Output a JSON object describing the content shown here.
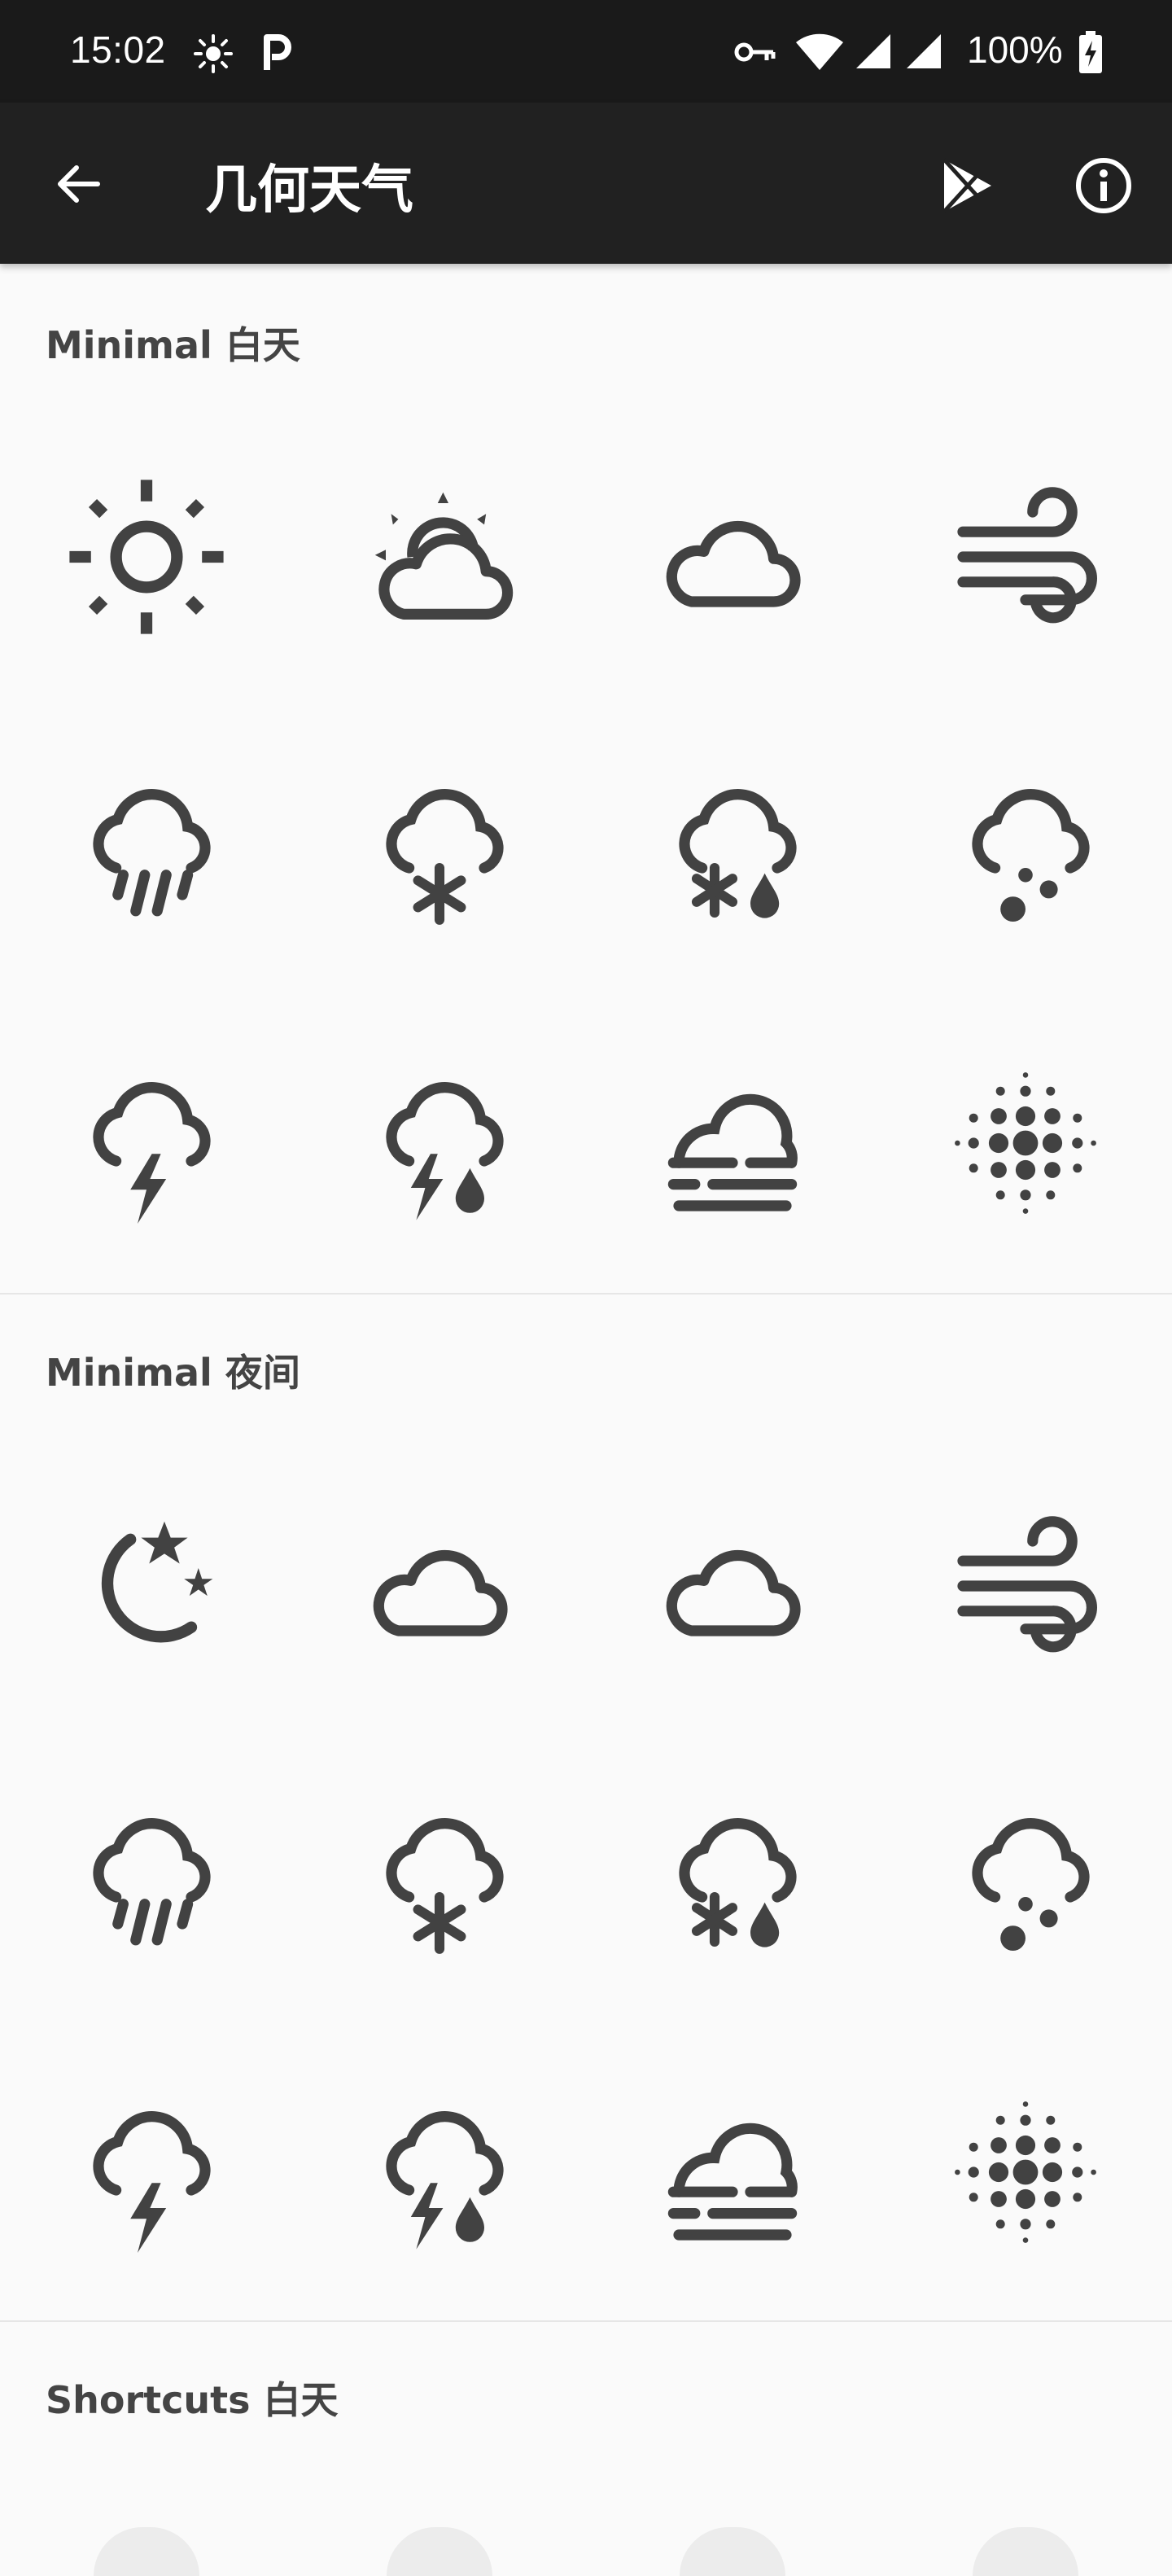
{
  "status_bar": {
    "time": "15:02",
    "battery": "100%"
  },
  "app_bar": {
    "title": "几何天气"
  },
  "sections": [
    {
      "title": "Minimal 白天",
      "icons": [
        "sun-icon",
        "partly-cloudy-day-icon",
        "cloud-icon",
        "wind-icon",
        "rain-icon",
        "snow-icon",
        "sleet-icon",
        "hail-icon",
        "thunder-icon",
        "thunderstorm-icon",
        "fog-icon",
        "haze-icon"
      ]
    },
    {
      "title": "Minimal 夜间",
      "icons": [
        "clear-night-icon",
        "partly-cloudy-night-icon",
        "cloud-icon",
        "wind-icon",
        "rain-icon",
        "snow-icon",
        "sleet-icon",
        "hail-icon",
        "thunder-icon",
        "thunderstorm-icon",
        "fog-icon",
        "haze-icon"
      ]
    },
    {
      "title": "Shortcuts 白天",
      "icons": []
    }
  ]
}
